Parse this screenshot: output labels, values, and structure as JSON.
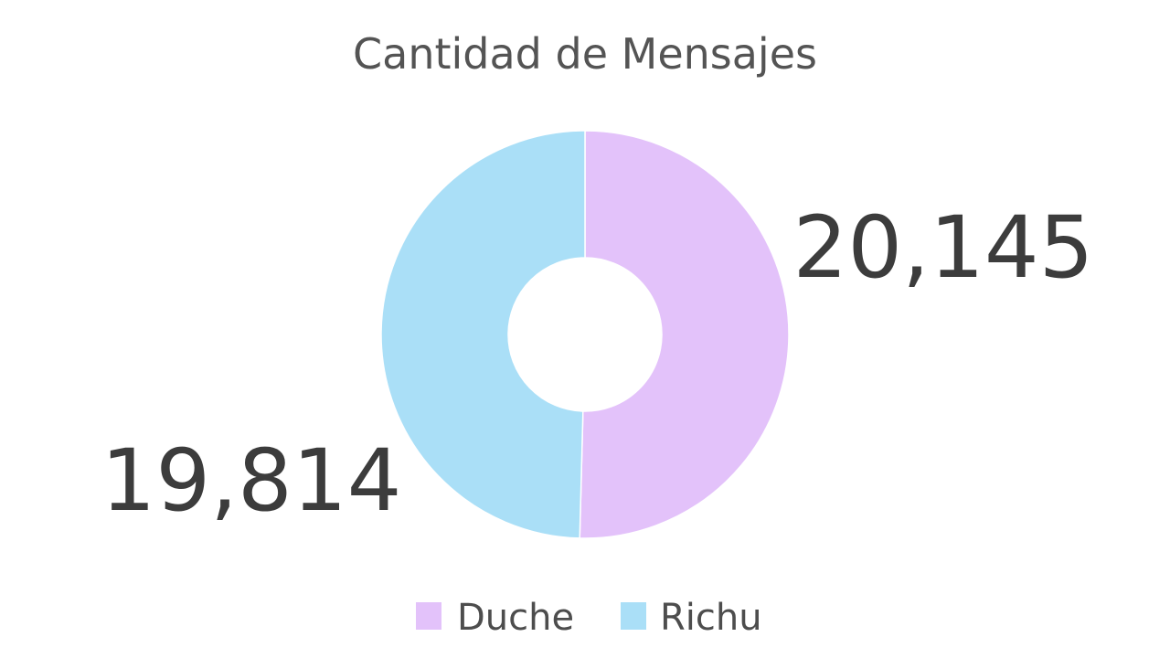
{
  "chart_data": {
    "type": "pie",
    "title": "Cantidad de Mensajes",
    "categories": [
      "Duche",
      "Richu"
    ],
    "values": [
      20145,
      19814
    ],
    "value_labels": [
      "20,145",
      "19,814"
    ],
    "colors": [
      "#e3c2fa",
      "#aadff7"
    ],
    "donut": true,
    "start_angle_deg": 0,
    "direction": "clockwise",
    "legend_position": "bottom"
  }
}
